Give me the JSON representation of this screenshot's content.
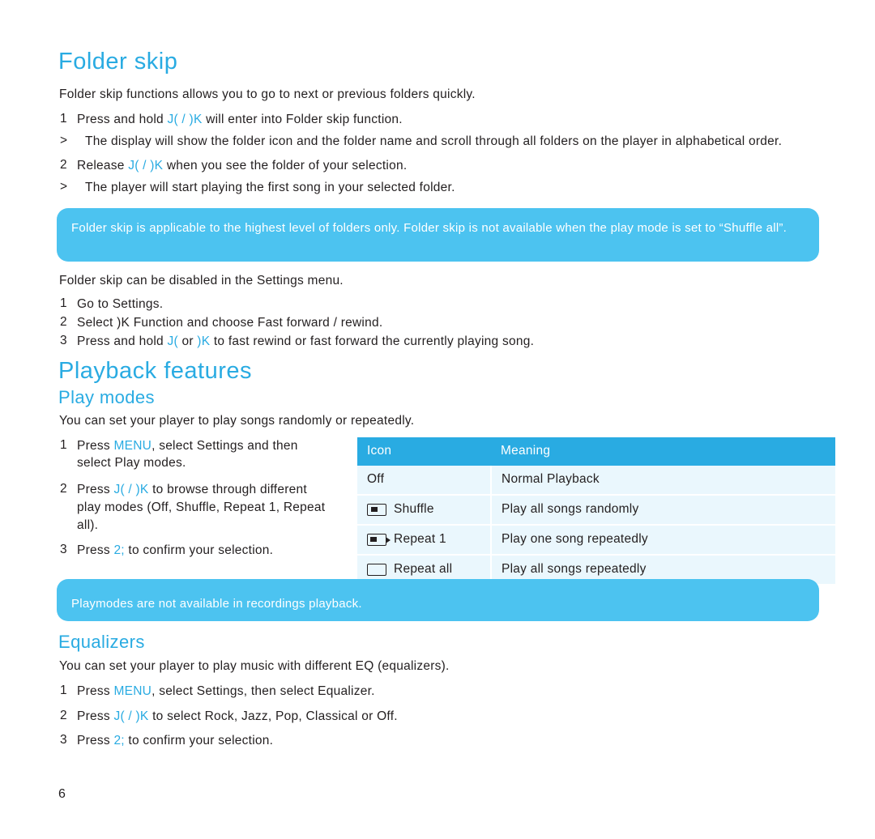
{
  "document": {
    "page_number": "6",
    "sections": {
      "folder_skip": {
        "heading": "Folder skip",
        "intro": "Folder skip functions allows you to go to next or previous folders quickly.",
        "steps": [
          {
            "marker": "1",
            "text_pre": "Press and hold ",
            "key": "J(  / )K",
            "text_post": " will enter into Folder skip function."
          },
          {
            "marker": ">",
            "text_pre": "The display will show the folder icon and the folder name and scroll through all folders on the player in alphabetical order.",
            "key": "",
            "text_post": ""
          },
          {
            "marker": "2",
            "text_pre": "Release ",
            "key": "J(  / )K",
            "text_post": " when you see the folder of your selection."
          },
          {
            "marker": ">",
            "text_pre": "The player will start playing the first song in your selected folder.",
            "key": "",
            "text_post": ""
          }
        ],
        "tip": "Folder skip is applicable to the highest level of folders only. Folder skip is not available when the play mode is set to “Shuffle all”.",
        "after_tip": "Folder skip can be disabled in the Settings menu.",
        "settings_steps": [
          {
            "marker": "1",
            "text": "Go to Settings."
          },
          {
            "marker": "2",
            "text": "Select )K Function and choose Fast forward / rewind."
          },
          {
            "marker": "3",
            "text_pre": "Press and hold ",
            "key": "J(",
            "mid": " or ",
            "key2": ")K",
            "text_post": " to fast rewind or fast forward the currently playing song."
          }
        ]
      },
      "playback_features": {
        "heading": "Playback features",
        "play_modes": {
          "heading": "Play modes",
          "intro": "You can set your player to play songs randomly or repeatedly.",
          "steps": [
            {
              "marker": "1",
              "pre": "Press ",
              "key": "MENU",
              "post": ", select Settings and then",
              "line2": "select Play modes."
            },
            {
              "marker": "2",
              "pre": "Press ",
              "key": "J(  / )K",
              "post": " to browse through different",
              "line2": "play modes (Off, Shuffle, Repeat 1, Repeat",
              "line3": "all)."
            },
            {
              "marker": "3",
              "pre": "Press ",
              "key": "2;",
              "post": " to confirm your selection."
            }
          ],
          "table": {
            "headers": [
              "Icon",
              "Meaning"
            ],
            "rows": [
              {
                "icon_type": "none",
                "icon_label": "Off",
                "meaning": "Normal Playback"
              },
              {
                "icon_type": "shuffle",
                "icon_label": "Shuffle",
                "meaning": "Play all songs randomly"
              },
              {
                "icon_type": "repeat1",
                "icon_label": "Repeat 1",
                "meaning": "Play one song repeatedly"
              },
              {
                "icon_type": "repeatall",
                "icon_label": "Repeat all",
                "meaning": "Play all songs repeatedly"
              }
            ]
          },
          "tip": "Playmodes are not available in recordings playback."
        },
        "equalizers": {
          "heading": "Equalizers",
          "intro": "You can set your player to play music with different EQ (equalizers).",
          "steps": [
            {
              "marker": "1",
              "pre": "Press ",
              "key": "MENU",
              "post": ", select Settings, then select Equalizer."
            },
            {
              "marker": "2",
              "pre": "Press ",
              "key": "J(  / )K",
              "post": " to select Rock, Jazz, Pop, Classical or Off."
            },
            {
              "marker": "3",
              "pre": "Press ",
              "key": "2;",
              "post": " to confirm your selection."
            }
          ]
        }
      }
    }
  },
  "colors": {
    "accent": "#29abe2",
    "tip_bg": "#4cc3f0",
    "table_row_bg": "#eaf7fd",
    "text": "#231f20"
  }
}
